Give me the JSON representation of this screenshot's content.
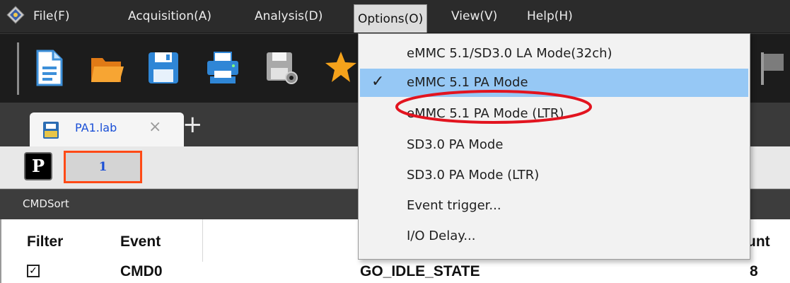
{
  "menubar": {
    "items": [
      "File(F)",
      "Acquisition(A)",
      "Analysis(D)",
      "Options(O)",
      "View(V)",
      "Help(H)"
    ]
  },
  "toolbar": {
    "buttons": [
      "new-file-icon",
      "open-folder-icon",
      "save-icon",
      "print-icon",
      "save-settings-icon",
      "favorite-star-icon",
      "flag-icon"
    ]
  },
  "tabs": {
    "document_tab": "PA1.lab",
    "close_glyph": "×",
    "new_tab_glyph": "+"
  },
  "pages": {
    "p_button": "P",
    "page_tab": "1"
  },
  "panel": {
    "title": "CMDSort"
  },
  "table": {
    "headers": {
      "filter": "Filter",
      "event": "Event",
      "count": "unt"
    },
    "rows": [
      {
        "checked": true,
        "check_glyph": "✓",
        "event": "CMD0",
        "name": "GO_IDLE_STATE",
        "count": "8"
      }
    ]
  },
  "options_menu": {
    "items": [
      {
        "label": "eMMC 5.1/SD3.0 LA Mode(32ch)",
        "checked": false
      },
      {
        "label": "eMMC 5.1 PA Mode",
        "checked": true,
        "check_glyph": "✓"
      },
      {
        "label": "eMMC 5.1 PA Mode (LTR)",
        "checked": false
      },
      {
        "label": "SD3.0 PA Mode",
        "checked": false
      },
      {
        "label": "SD3.0 PA Mode (LTR)",
        "checked": false
      },
      {
        "label": "Event trigger...",
        "checked": false
      },
      {
        "label": "I/O Delay...",
        "checked": false
      }
    ]
  },
  "colors": {
    "selection": "#96c8f5",
    "annotation_red": "#e2141f",
    "page_tab_border": "#ff4a16",
    "link_blue": "#1a4fd6"
  }
}
